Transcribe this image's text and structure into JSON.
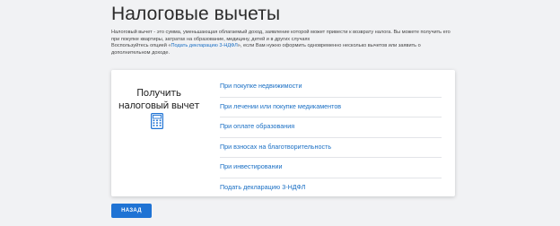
{
  "page_title": "Налоговые вычеты",
  "intro": {
    "line1": "Налоговый вычет - это сумма, уменьшающая облагаемый доход, заявление которой может привести к возврату налога. Вы можете получить его при покупке квартиры, затратах на образование, медицину, детей и в других случаях",
    "line2_before": "Воспользуйтесь опцией «",
    "line2_link": "Подать декларацию 3-НДФЛ",
    "line2_after": "», если Вам нужно оформить одновременно несколько вычетов или заявить о дополнительном доходе."
  },
  "card": {
    "heading_line1": "Получить",
    "heading_line2": "налоговый вычет",
    "icon": "calculator-icon",
    "options": [
      {
        "label": "При покупке недвижимости"
      },
      {
        "label": "При лечении или покупке медикаментов"
      },
      {
        "label": "При оплате образования"
      },
      {
        "label": "При взносах на благотворительность"
      },
      {
        "label": "При инвестировании"
      },
      {
        "label": "Подать декларацию 3-НДФЛ"
      }
    ]
  },
  "back_button": {
    "label": "НАЗАД"
  },
  "colors": {
    "accent": "#1f73d4",
    "link": "#1a6fc4",
    "background": "#f1f2f4"
  }
}
